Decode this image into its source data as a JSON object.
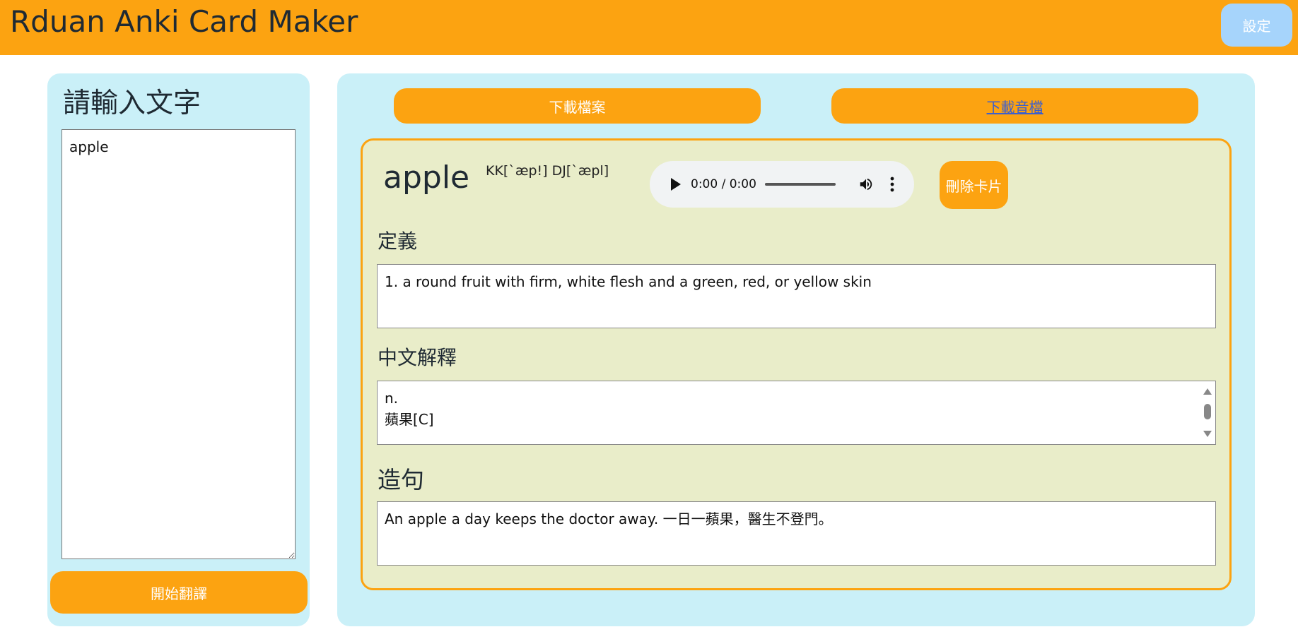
{
  "header": {
    "title": "Rduan Anki Card Maker",
    "settings_label": "設定"
  },
  "input_panel": {
    "heading": "請輸入文字",
    "text_value": "apple",
    "translate_label": "開始翻譯"
  },
  "card_panel": {
    "download_file_label": "下載檔案",
    "download_audio_label": "下載音檔",
    "card": {
      "word": "apple",
      "phonetic": "KK[ˋæp!] DJ[ˋæpl]",
      "audio": {
        "time": "0:00 / 0:00"
      },
      "delete_label": "刪除卡片",
      "definition_label": "定義",
      "definition_text": "1. a round fruit with firm, white flesh and a green, red, or yellow skin",
      "chinese_label": "中文解釋",
      "chinese_lines": [
        "n.",
        "蘋果[C]"
      ],
      "example_label": "造句",
      "example_text": "An apple a day keeps the doctor away. 一日一蘋果，醫生不登門。"
    }
  },
  "colors": {
    "accent": "#fca311",
    "panel_bg": "#caf0f8",
    "card_bg": "#e9edc9",
    "settings_bg": "#a6d4fb"
  }
}
